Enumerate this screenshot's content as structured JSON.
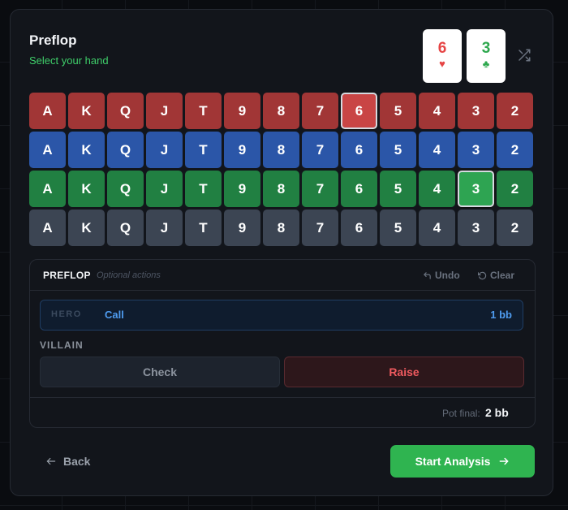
{
  "header": {
    "title": "Preflop",
    "subtitle": "Select your hand"
  },
  "selected_cards": [
    {
      "rank": "6",
      "suit": "♥",
      "color": "#e64545"
    },
    {
      "rank": "3",
      "suit": "♣",
      "color": "#2ea84e"
    }
  ],
  "shuffle_icon": "shuffle-icon",
  "ranks": [
    "A",
    "K",
    "Q",
    "J",
    "T",
    "9",
    "8",
    "7",
    "6",
    "5",
    "4",
    "3",
    "2"
  ],
  "suit_rows": [
    {
      "suit": "hearts",
      "color": "#a13636",
      "selected_rank": "6"
    },
    {
      "suit": "diamonds",
      "color": "#2b56a8",
      "selected_rank": null
    },
    {
      "suit": "clubs",
      "color": "#218042",
      "selected_rank": "3"
    },
    {
      "suit": "spades",
      "color": "#3c4553",
      "selected_rank": null
    }
  ],
  "actions": {
    "heading": "PREFLOP",
    "optional": "Optional actions",
    "undo_label": "Undo",
    "clear_label": "Clear",
    "hero": {
      "label": "HERO",
      "action": "Call",
      "amount": "1 bb"
    },
    "villain_label": "VILLAIN",
    "check_label": "Check",
    "raise_label": "Raise",
    "pot_label": "Pot final:",
    "pot_value": "2 bb"
  },
  "footer": {
    "back_label": "Back",
    "start_label": "Start Analysis"
  },
  "colors": {
    "accent_green": "#2fb450",
    "hero_blue": "#4f9cf0",
    "raise_red": "#ef5a5f"
  }
}
